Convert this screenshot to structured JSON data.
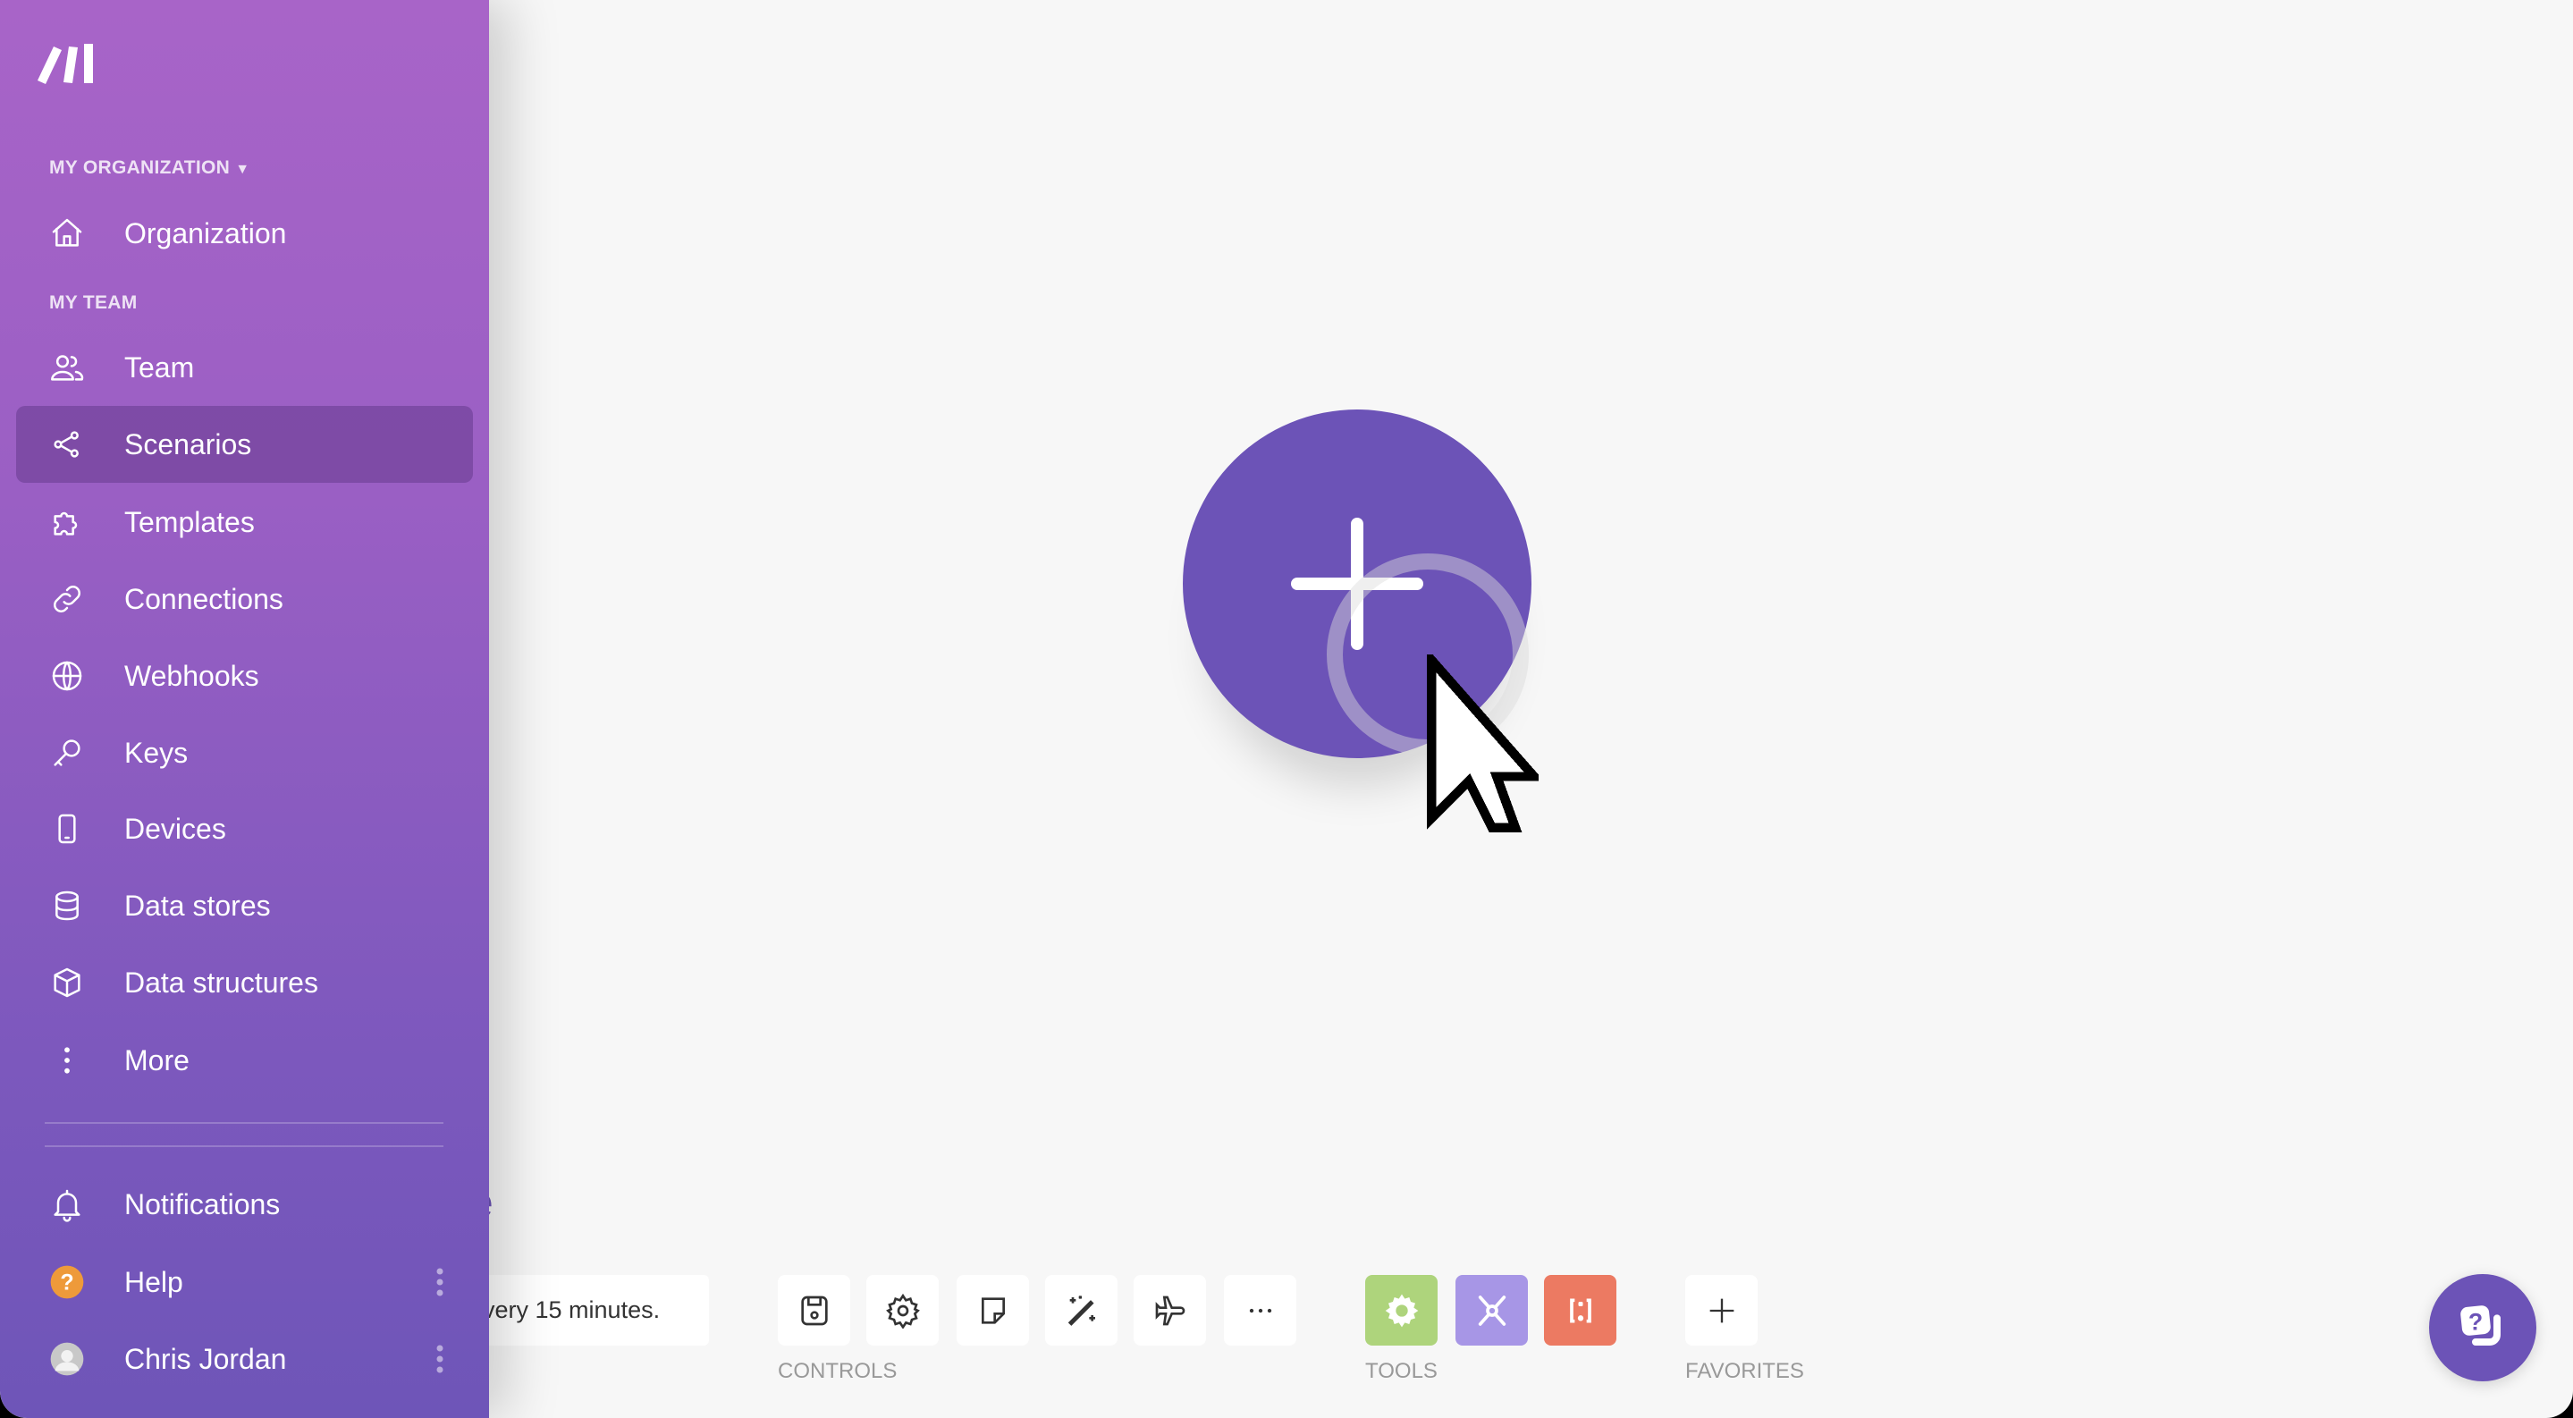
{
  "sidebar": {
    "logo_icon": "make-logo-icon",
    "org_section": "MY ORGANIZATION",
    "team_section": "MY TEAM",
    "items": [
      {
        "label": "Organization",
        "icon": "home-icon"
      },
      {
        "label": "Team",
        "icon": "users-icon"
      },
      {
        "label": "Scenarios",
        "icon": "share-nodes-icon",
        "active": true
      },
      {
        "label": "Templates",
        "icon": "puzzle-icon"
      },
      {
        "label": "Connections",
        "icon": "link-icon"
      },
      {
        "label": "Webhooks",
        "icon": "globe-icon"
      },
      {
        "label": "Keys",
        "icon": "key-icon"
      },
      {
        "label": "Devices",
        "icon": "mobile-icon"
      },
      {
        "label": "Data stores",
        "icon": "database-icon"
      },
      {
        "label": "Data structures",
        "icon": "cube-icon"
      },
      {
        "label": "More",
        "icon": "vertical-dots-icon"
      }
    ],
    "bottom": [
      {
        "label": "Notifications",
        "icon": "bell-icon"
      },
      {
        "label": "Help",
        "icon": "question-circle-icon"
      },
      {
        "label": "Chris Jordan",
        "icon": "avatar"
      }
    ]
  },
  "canvas": {
    "partial_title": "e",
    "schedule_text": "very 15 minutes.",
    "controls_label": "CONTROLS",
    "tools_label": "TOOLS",
    "favorites_label": "FAVORITES",
    "controls": [
      "save-icon",
      "gear-icon",
      "note-icon",
      "magic-wand-icon",
      "airplane-icon",
      "more-horizontal-icon"
    ],
    "tools": [
      {
        "icon": "gear-icon",
        "color": "#aed47c"
      },
      {
        "icon": "tools-icon",
        "color": "#a796e6"
      },
      {
        "icon": "brackets-icon",
        "color": "#ec7a62"
      }
    ]
  },
  "colors": {
    "accent": "#6c53b7",
    "canvas": "#f7f7f7"
  }
}
